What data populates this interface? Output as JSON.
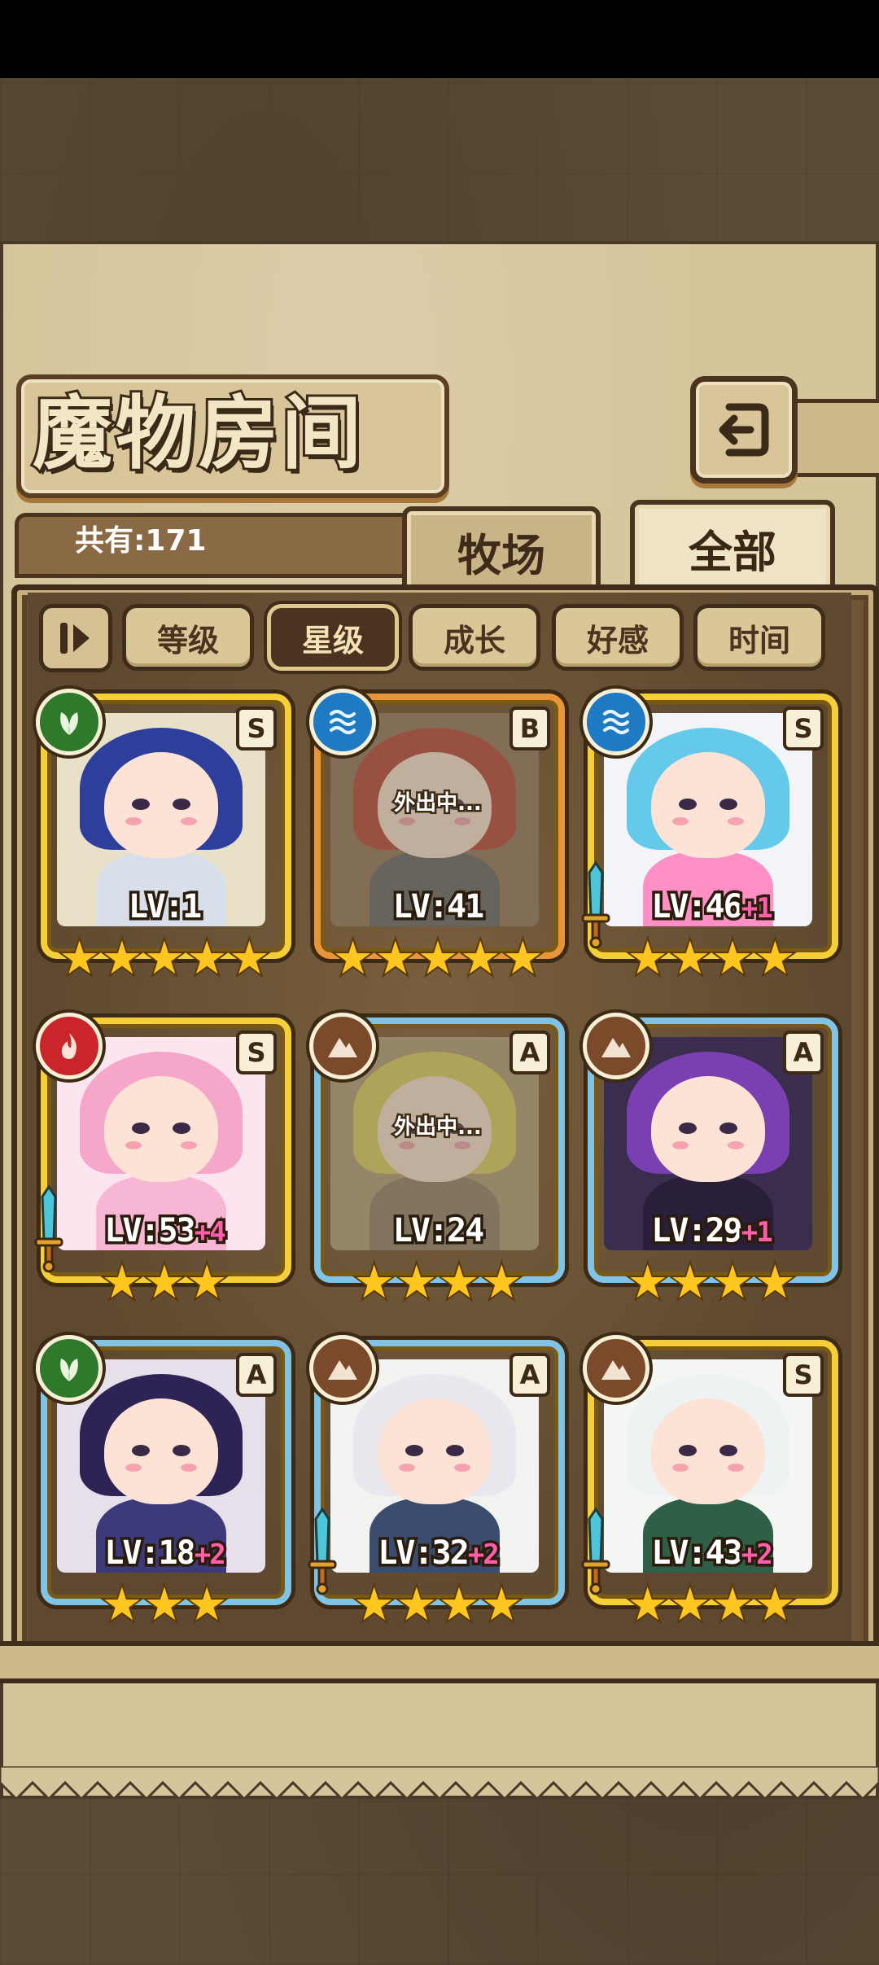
{
  "title": "魔物房间",
  "count_label": "共有:171",
  "tabs": [
    {
      "label": "牧场",
      "active": false
    },
    {
      "label": "全部",
      "active": true
    }
  ],
  "sort": {
    "toggle_icon": "sort-direction-icon",
    "buttons": [
      {
        "label": "等级",
        "active": false
      },
      {
        "label": "星级",
        "active": true
      },
      {
        "label": "成长",
        "active": false
      },
      {
        "label": "好感",
        "active": false
      },
      {
        "label": "时间",
        "active": false
      }
    ]
  },
  "away_text": "外出中...",
  "monsters": [
    {
      "element": "nature-icon",
      "element_color": "#2f7a2a",
      "grade": "S",
      "frame": "#f4cf37",
      "level": "LV:1",
      "bonus": "",
      "stars": 5,
      "away": false,
      "weapon": false,
      "hair": "#2d3f9a",
      "body": "#d9dfe8",
      "bg": "#e9e0c8"
    },
    {
      "element": "water-icon",
      "element_color": "#1f7ac4",
      "grade": "B",
      "frame": "#e8953a",
      "level": "LV:41",
      "bonus": "",
      "stars": 5,
      "away": true,
      "weapon": false,
      "hair": "#b23a2a",
      "body": "#5a5a60",
      "bg": "#8a6e52"
    },
    {
      "element": "water-icon",
      "element_color": "#1f7ac4",
      "grade": "S",
      "frame": "#f4cf37",
      "level": "LV:46",
      "bonus": "+1",
      "stars": 4,
      "away": false,
      "weapon": true,
      "hair": "#65c9ea",
      "body": "#ff8fc5",
      "bg": "#f2f4f8"
    },
    {
      "element": "fire-icon",
      "element_color": "#c9252a",
      "grade": "S",
      "frame": "#f4cf37",
      "level": "LV:53",
      "bonus": "+4",
      "stars": 3,
      "away": false,
      "weapon": true,
      "hair": "#f6a6c9",
      "body": "#f7b6d3",
      "bg": "#fde5ef"
    },
    {
      "element": "earth-icon",
      "element_color": "#7a4a2a",
      "grade": "A",
      "frame": "#7fc3e6",
      "level": "LV:24",
      "bonus": "",
      "stars": 4,
      "away": true,
      "weapon": false,
      "hair": "#d9cf5a",
      "body": "#8a7b65",
      "bg": "#b09a74"
    },
    {
      "element": "earth-icon",
      "element_color": "#7a4a2a",
      "grade": "A",
      "frame": "#7fc3e6",
      "level": "LV:29",
      "bonus": "+1",
      "stars": 4,
      "away": false,
      "weapon": false,
      "hair": "#7a3fb0",
      "body": "#2a1f3a",
      "bg": "#3b2d4d"
    },
    {
      "element": "nature-icon",
      "element_color": "#2f7a2a",
      "grade": "A",
      "frame": "#7fc3e6",
      "level": "LV:18",
      "bonus": "+2",
      "stars": 3,
      "away": false,
      "weapon": false,
      "hair": "#2d2455",
      "body": "#3d3a7a",
      "bg": "#e7dfe9"
    },
    {
      "element": "earth-icon",
      "element_color": "#7a4a2a",
      "grade": "A",
      "frame": "#7fc3e6",
      "level": "LV:32",
      "bonus": "+2",
      "stars": 4,
      "away": false,
      "weapon": true,
      "hair": "#e8e8ee",
      "body": "#3a4d6e",
      "bg": "#f2f2f0"
    },
    {
      "element": "earth-icon",
      "element_color": "#7a4a2a",
      "grade": "S",
      "frame": "#f4cf37",
      "level": "LV:43",
      "bonus": "+2",
      "stars": 4,
      "away": false,
      "weapon": true,
      "hair": "#eef2f2",
      "body": "#2f5f46",
      "bg": "#f4f6f4"
    }
  ]
}
